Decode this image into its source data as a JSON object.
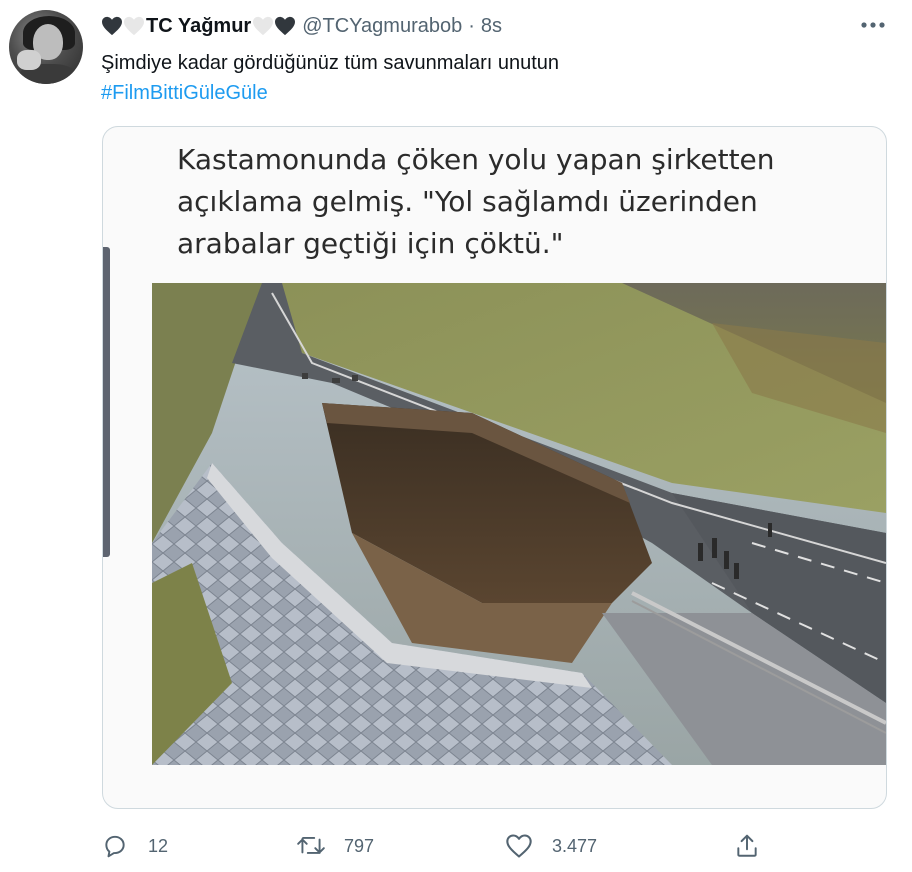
{
  "tweet": {
    "display_name": "TC Yağmur",
    "handle": "@TCYagmurabob",
    "separator": "·",
    "timestamp": "8s",
    "text": "Şimdiye kadar gördüğünüz tüm savunmaları unutun",
    "hashtag": "#FilmBittiGüleGüle"
  },
  "media": {
    "caption_lines": [
      "Kastamonunda çöken yolu yapan şirketten",
      "açıklama gelmiş. \"Yol sağlamdı üzerinden",
      "arabalar geçtiği için çöktü.\""
    ]
  },
  "actions": {
    "reply_count": "12",
    "retweet_count": "797",
    "like_count": "3.477"
  },
  "icons": {
    "more": "more-icon",
    "reply": "reply-icon",
    "retweet": "retweet-icon",
    "like": "like-icon",
    "share": "share-icon"
  },
  "colors": {
    "link": "#1d9bf0",
    "secondary_text": "#536471",
    "border": "#cfd9de"
  }
}
